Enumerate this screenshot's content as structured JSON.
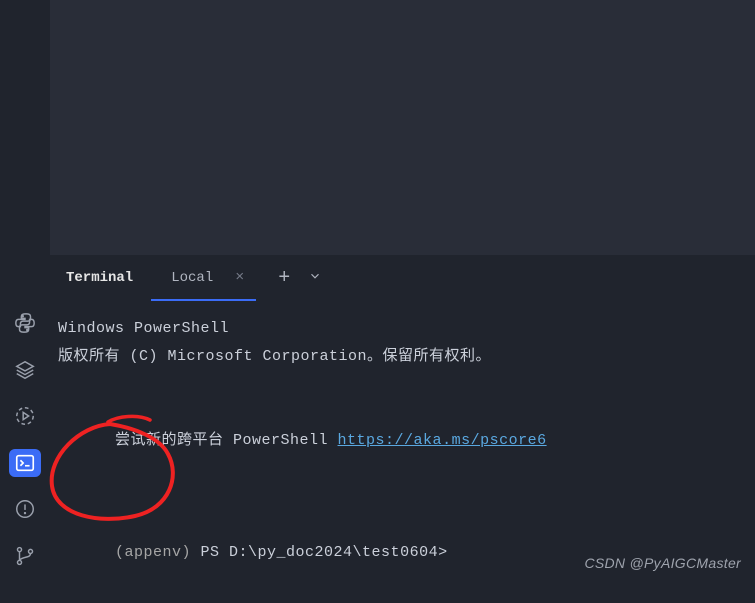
{
  "tabs": {
    "title": "Terminal",
    "local_label": "Local",
    "close_glyph": "×",
    "add_glyph": "+"
  },
  "terminal": {
    "line1": "Windows PowerShell",
    "line2": "版权所有 (C) Microsoft Corporation。保留所有权利。",
    "line3_pre": "尝试新的跨平台 PowerShell ",
    "line3_link": "https://aka.ms/pscore6",
    "prompt_env": "(appenv)",
    "prompt_path": " PS D:\\py_doc2024\\test0604>"
  },
  "watermark": "CSDN @PyAIGCMaster",
  "icons": {
    "python": "python-icon",
    "layers": "layers-icon",
    "play": "play-circle-icon",
    "terminal": "terminal-icon",
    "warning": "warning-circle-icon",
    "git": "git-branch-icon"
  }
}
